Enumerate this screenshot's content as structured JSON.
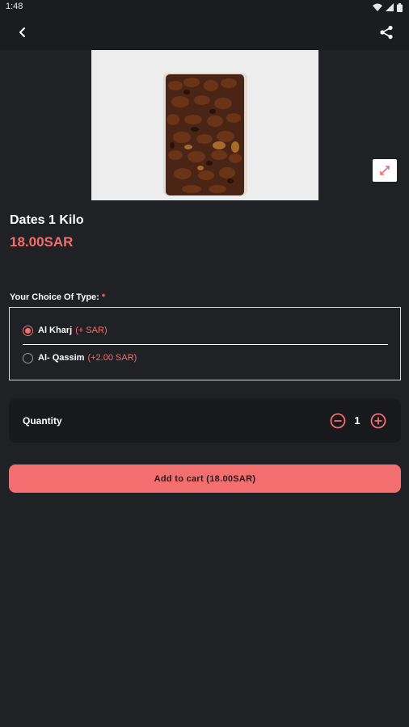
{
  "status_bar": {
    "time": "1:48",
    "icons": [
      "wifi-icon",
      "signal-icon",
      "battery-icon"
    ]
  },
  "app_bar": {
    "back_icon": "chevron-left-icon",
    "share_icon": "share-icon"
  },
  "product": {
    "image_alt": "dates-package",
    "name": "Dates 1 Kilo",
    "price": "18.00SAR",
    "expand_icon": "expand-icon"
  },
  "choice": {
    "label": "Your Choice Of Type:",
    "required_mark": "*",
    "options": [
      {
        "name": "Al Kharj",
        "price": "(+ SAR)",
        "selected": true
      },
      {
        "name": "Al- Qassim",
        "price": "(+2.00 SAR)",
        "selected": false
      }
    ]
  },
  "quantity": {
    "label": "Quantity",
    "value": "1",
    "minus_icon": "minus-circle-icon",
    "plus_icon": "plus-circle-icon"
  },
  "cart": {
    "button_label": "Add to cart (18.00SAR)"
  },
  "colors": {
    "accent": "#f36e6e",
    "background": "#202125",
    "bar": "#1b1c1f"
  }
}
